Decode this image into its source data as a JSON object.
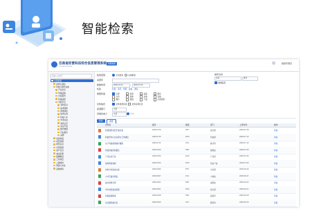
{
  "heading": "智能检索",
  "header": {
    "system_title": "云南省民营科技综合信息管理系统",
    "system_subtitle": "Yunnan Province",
    "badge": "智能检索",
    "user": "超级管理员"
  },
  "sidebar": {
    "search_placeholder": "请输入关键字",
    "items": [
      {
        "label": "全部资源",
        "active": true,
        "indent": 0
      },
      {
        "label": "新闻与通知",
        "indent": 1
      },
      {
        "label": "科技与服务动态",
        "indent": 1
      },
      {
        "label": "产业信息",
        "indent": 2
      },
      {
        "label": "科技政策",
        "indent": 2
      },
      {
        "label": "企业服务",
        "indent": 2
      },
      {
        "label": "科技成果",
        "indent": 2
      },
      {
        "label": "创新平台",
        "indent": 2
      },
      {
        "label": "专利信息",
        "indent": 3
      },
      {
        "label": "技术转移",
        "indent": 3
      },
      {
        "label": "成果转化",
        "indent": 3
      },
      {
        "label": "技术标准",
        "indent": 3
      },
      {
        "label": "科技人才",
        "indent": 3
      },
      {
        "label": "学术交流",
        "indent": 3
      },
      {
        "label": "资质认定",
        "indent": 3
      },
      {
        "label": "知识产权",
        "indent": 3
      },
      {
        "label": "统计数据",
        "indent": 3
      },
      {
        "label": "行业报告",
        "indent": 3
      },
      {
        "label": "其他",
        "indent": 3
      },
      {
        "label": "项目申报",
        "indent": 1
      },
      {
        "label": "项目管理",
        "indent": 1
      },
      {
        "label": "财务信息",
        "indent": 1
      },
      {
        "label": "合同管理",
        "indent": 1
      },
      {
        "label": "资产信息",
        "indent": 1
      },
      {
        "label": "会议纪要",
        "indent": 1
      },
      {
        "label": "规章制度",
        "indent": 1
      },
      {
        "label": "工作总结",
        "indent": 1
      },
      {
        "label": "上报材料",
        "indent": 1
      },
      {
        "label": "党建与文化",
        "indent": 1
      },
      {
        "label": "其他资料",
        "indent": 1
      }
    ]
  },
  "filters": {
    "scope_label": "检索范围",
    "scope_options": [
      "全文检索",
      "标题检索"
    ],
    "keyword_label": "关键字",
    "date_label": "起始时间",
    "date_from": "2020-01-01",
    "date_to": "2020-07-31",
    "tags_label": "标签",
    "tags": [
      "科技",
      "资讯",
      "管理",
      "政策",
      "通知"
    ],
    "category_label": "类型筛选",
    "category_options": [
      "全部",
      "新闻",
      "政策",
      "报告",
      "公告",
      "其他",
      "文档",
      "表格",
      "图片",
      "视频",
      "下载",
      "全部类型"
    ],
    "format_label": "文件格式",
    "format_options": [
      "文件类型筛选",
      "文件名称包含"
    ],
    "source_label": "来源部门",
    "source_value": "全部",
    "owner_label": "归档负责人",
    "owner_value": "全部",
    "owner_extra": "个人",
    "sort_label": "排序方式",
    "sort_value": "时间",
    "order_value": "降序",
    "exact_label": "精确匹配",
    "search_button": "检索",
    "reset_button": "重置"
  },
  "table": {
    "headers": [
      "",
      "文件名",
      "编号",
      "类型",
      "部门",
      "上传时间",
      "操作"
    ],
    "rows": [
      {
        "name": "智慧园区项目汇报方案",
        "code": "2020-0718",
        "type": "PPT",
        "dept": "综合部",
        "date": "2020-07-18",
        "op": "查看"
      },
      {
        "name": "科技型中小企业评价工作通知",
        "code": "2020-0715",
        "type": "DOC",
        "dept": "科技部",
        "date": "2020-07-15",
        "op": "查看"
      },
      {
        "name": "关于科技成果统计数据",
        "code": "2020-0712",
        "type": "XLS",
        "dept": "统计科",
        "date": "2020-07-12",
        "op": "查看"
      },
      {
        "name": "年度科技创新报告",
        "code": "2020-0709",
        "type": "PDF",
        "dept": "规划处",
        "date": "2020-07-09",
        "op": "查看"
      },
      {
        "name": "产业信息汇总",
        "code": "2020-0706",
        "type": "DOC",
        "dept": "产业科",
        "date": "2020-07-06",
        "op": "查看"
      },
      {
        "name": "专利申请材料",
        "code": "2020-0703",
        "type": "DOC",
        "dept": "知识产权",
        "date": "2020-07-03",
        "op": "查看"
      },
      {
        "name": "创新平台建设方案",
        "code": "2020-0630",
        "type": "PPT",
        "dept": "平台部",
        "date": "2020-06-30",
        "op": "查看"
      },
      {
        "name": "人才引进计划表",
        "code": "2020-0627",
        "type": "XLS",
        "dept": "人事处",
        "date": "2020-06-27",
        "op": "查看"
      },
      {
        "name": "技术转移合同",
        "code": "2020-0624",
        "type": "PDF",
        "dept": "成果处",
        "date": "2020-06-24",
        "op": "查看"
      },
      {
        "name": "学术交流会议纪要",
        "code": "2020-0621",
        "type": "DOC",
        "dept": "综合部",
        "date": "2020-06-21",
        "op": "查看"
      },
      {
        "name": "科技政策解读",
        "code": "2020-0618",
        "type": "PDF",
        "dept": "政策室",
        "date": "2020-06-18",
        "op": "查看"
      },
      {
        "name": "企业服务统计表",
        "code": "2020-0615",
        "type": "XLS",
        "dept": "服务科",
        "date": "2020-06-15",
        "op": "查看"
      },
      {
        "name": "资质认定申报书",
        "code": "2020-0612",
        "type": "DOC",
        "dept": "认定处",
        "date": "2020-06-12",
        "op": "查看"
      }
    ]
  },
  "colors": {
    "accent": "#2f6fd0",
    "art_blue": "#3d86e0",
    "art_light": "#b9d8f7"
  }
}
